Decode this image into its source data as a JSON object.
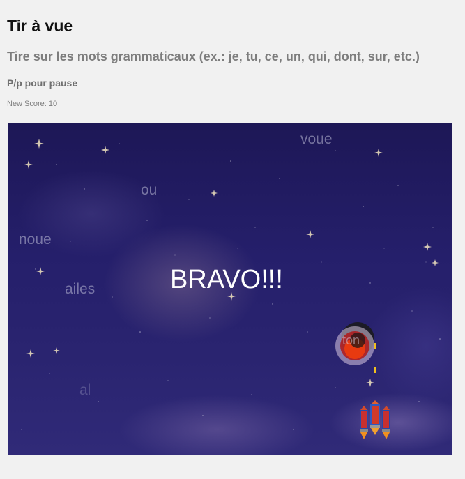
{
  "header": {
    "title": "Tir à vue",
    "instructions": "Tire sur les mots grammaticaux (ex.: je, tu, ce, un, qui, dont, sur, etc.)",
    "pause_hint": "P/p pour pause",
    "score_label": "New Score:",
    "score_value": "10"
  },
  "game": {
    "status_message": "BRAVO!!!",
    "falling_words": [
      "voue",
      "ou",
      "noue",
      "ailes",
      "al",
      "ton"
    ],
    "colors": {
      "sky_top": "#1d1756",
      "sky_bottom": "#302a78",
      "message": "#ffffff",
      "bullet": "#f0c020"
    },
    "icons": [
      "explosion-icon",
      "rocket-ship-icon",
      "star-icon"
    ]
  }
}
